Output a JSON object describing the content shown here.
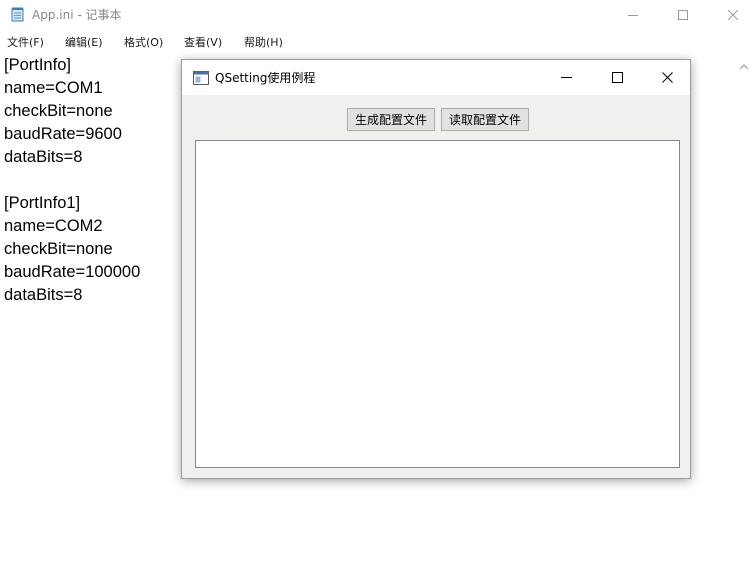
{
  "notepad": {
    "title": "App.ini - 记事本",
    "menu": [
      "文件(F)",
      "编辑(E)",
      "格式(O)",
      "查看(V)",
      "帮助(H)"
    ],
    "lines": [
      "[PortInfo]",
      "name=COM1",
      "checkBit=none",
      "baudRate=9600",
      "dataBits=8",
      "",
      "[PortInfo1]",
      "name=COM2",
      "checkBit=none",
      "baudRate=100000",
      "dataBits=8"
    ]
  },
  "dialog": {
    "title": "QSetting使用例程",
    "buttons": {
      "generate": "生成配置文件",
      "read": "读取配置文件"
    },
    "text_content": ""
  },
  "icons": {
    "notepad_app": "notepad-icon",
    "dialog_app": "qt-window-icon",
    "minimize": "minimize-icon",
    "maximize": "maximize-icon",
    "close": "close-icon",
    "scroll_up": "scroll-up-arrow-icon"
  },
  "colors": {
    "dialog_body": "#f0f0f0",
    "button_face": "#e1e1e1",
    "title_inactive_text": "#888888"
  }
}
